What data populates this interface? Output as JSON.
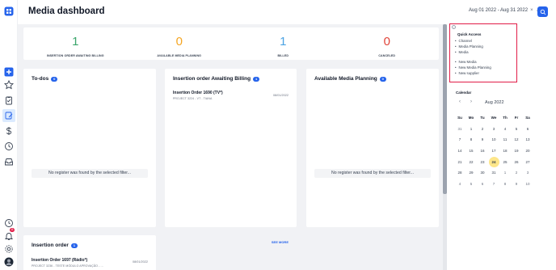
{
  "header": {
    "title": "Media dashboard",
    "date_range": "Aug 01 2022 - Aug 31 2022",
    "clear_glyph": "×",
    "chevron_glyph": "⌄"
  },
  "rail": {
    "icons": [
      "app-logo-icon",
      "add-icon",
      "star-icon",
      "clipboard-icon",
      "edit-document-icon",
      "dollar-icon",
      "clock-history-icon",
      "inbox-icon",
      "clock-icon",
      "bell-icon",
      "settings-icon",
      "avatar"
    ],
    "notification_count": "11"
  },
  "stats": [
    {
      "value": "1",
      "label": "INSERTION ORDER AWAITING BILLING",
      "color": "#3aa56b"
    },
    {
      "value": "0",
      "label": "AVAILABLE MEDIA PLANNING",
      "color": "#f5a623"
    },
    {
      "value": "1",
      "label": "BILLED",
      "color": "#4ba3e3"
    },
    {
      "value": "0",
      "label": "CANCELED",
      "color": "#e0453a"
    }
  ],
  "todos": {
    "title": "To-dos",
    "count": "0",
    "empty": "No register was found by the selected filter..."
  },
  "billing": {
    "title": "Insertion order Awaiting Billing",
    "count": "1",
    "item_title": "Insertion Order 1690 (TV*)",
    "item_sub": "PROJECT 3224 - VT - TIANA",
    "item_date": "08/01/2022",
    "see_more": "SEE MORE"
  },
  "planning": {
    "title": "Available Media Planning",
    "count": "0",
    "empty": "No register was found by the selected filter..."
  },
  "insertion_order": {
    "title": "Insertion order",
    "count": "1",
    "item_title": "Insertion Order 1697 (Rádio*)",
    "item_sub": "PROJECT 3236 - TESTE MÓDULO APROVAÇÃO - ...",
    "item_date": "08/01/2022"
  },
  "quick_access": {
    "title": "Quick Access",
    "group1": [
      "Channel",
      "Media Planning",
      "Media"
    ],
    "group2": [
      "New Media",
      "New Media Planning",
      "New supplier"
    ]
  },
  "calendar": {
    "title": "Calendar",
    "prev": "‹",
    "next": "›",
    "month": "Aug 2022",
    "weekdays": [
      "Su",
      "Mo",
      "Tu",
      "We",
      "Th",
      "Fr",
      "Sa"
    ],
    "weeks": [
      [
        "31",
        "1",
        "2",
        "3",
        "4",
        "5",
        "6"
      ],
      [
        "7",
        "8",
        "9",
        "10",
        "11",
        "12",
        "13"
      ],
      [
        "14",
        "15",
        "16",
        "17",
        "18",
        "19",
        "20"
      ],
      [
        "21",
        "22",
        "23",
        "24",
        "25",
        "26",
        "27"
      ],
      [
        "28",
        "29",
        "30",
        "31",
        "1",
        "2",
        "3"
      ],
      [
        "4",
        "5",
        "6",
        "7",
        "8",
        "9",
        "10"
      ]
    ],
    "today": "24",
    "accent": "#fde68a"
  },
  "colors": {
    "primary": "#2563eb",
    "highlight_border": "#e11d48"
  }
}
